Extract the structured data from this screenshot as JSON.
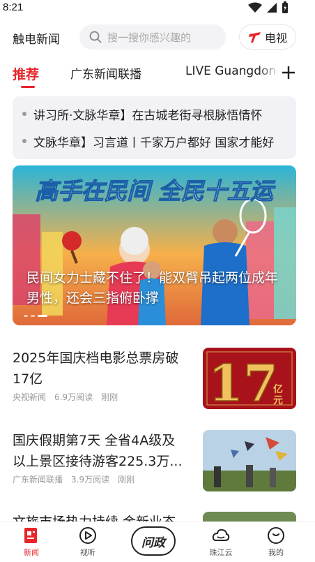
{
  "status": {
    "time": "8:21"
  },
  "header": {
    "brand": "触电新闻",
    "search_placeholder": "搜一搜你感兴趣的",
    "tv_label": "电视"
  },
  "tabs": [
    {
      "label": "推荐",
      "active": true
    },
    {
      "label": "广东新闻联播"
    },
    {
      "label": "LIVE Guangdong"
    }
  ],
  "ticker": [
    "讲习所·文脉华章】在古城老街寻根脉悟情怀",
    "文脉华章】习言道丨千家万户都好 国家才能好"
  ],
  "banner": {
    "headline": "高手在民间  全民十五运",
    "caption": "民间女力士藏不住了！能双臂吊起两位成年男性，还会三指俯卧撑"
  },
  "news": [
    {
      "title": "2025年国庆档电影总票房破17亿",
      "source": "央视新闻",
      "reads": "6.9万阅读",
      "time": "刚刚",
      "thumb_text": "17",
      "thumb_unit": "亿元"
    },
    {
      "title": "国庆假期第7天 全省4A级及以上景区接待游客225.3万...",
      "source": "广东新闻联播",
      "reads": "3.9万阅读",
      "time": "刚刚"
    },
    {
      "title": "文旅市场热力持续 金新业态"
    }
  ],
  "bottom_nav": [
    {
      "label": "新闻",
      "icon": "news-icon",
      "active": true
    },
    {
      "label": "视听",
      "icon": "play-icon"
    },
    {
      "label": "问政",
      "icon": "wenzheng-icon"
    },
    {
      "label": "珠江云",
      "icon": "cloud-icon"
    },
    {
      "label": "我的",
      "icon": "profile-icon"
    }
  ],
  "colors": {
    "accent": "#e8252a",
    "ticker_bg": "#f2f2f6"
  }
}
